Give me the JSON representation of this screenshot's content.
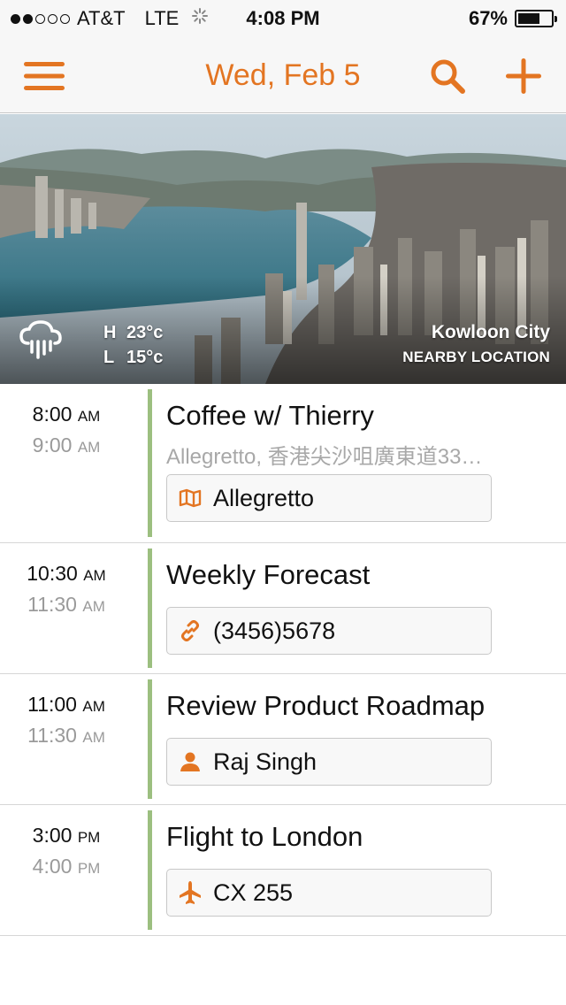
{
  "status_bar": {
    "carrier": "AT&T",
    "network": "LTE",
    "time": "4:08 PM",
    "battery": "67%",
    "battery_level": 0.67,
    "signal_bars_filled": 2,
    "signal_bars_total": 5
  },
  "nav": {
    "title": "Wed, Feb 5",
    "accent_color": "#e37522",
    "menu_icon": "menu-icon",
    "search_icon": "search-icon",
    "add_icon": "plus-icon"
  },
  "hero": {
    "weather_icon": "rain-cloud-icon",
    "high_label": "H",
    "high_temp": "23°c",
    "low_label": "L",
    "low_temp": "15°c",
    "location": "Kowloon City",
    "location_sub": "NEARBY LOCATION"
  },
  "events": [
    {
      "start_time": "8:00",
      "start_ampm": "AM",
      "end_time": "9:00",
      "end_ampm": "AM",
      "title": "Coffee w/ Thierry",
      "subtitle": "Allegretto, 香港尖沙咀廣東道33…",
      "chip_icon": "map-icon",
      "chip_label": "Allegretto"
    },
    {
      "start_time": "10:30",
      "start_ampm": "AM",
      "end_time": "11:30",
      "end_ampm": "AM",
      "title": "Weekly Forecast",
      "chip_icon": "link-icon",
      "chip_label": "(3456)5678"
    },
    {
      "start_time": "11:00",
      "start_ampm": "AM",
      "end_time": "11:30",
      "end_ampm": "AM",
      "title": "Review Product Roadmap",
      "chip_icon": "person-icon",
      "chip_label": "Raj Singh"
    },
    {
      "start_time": "3:00",
      "start_ampm": "PM",
      "end_time": "4:00",
      "end_ampm": "PM",
      "title": "Flight to London",
      "chip_icon": "airplane-icon",
      "chip_label": "CX 255"
    }
  ],
  "colors": {
    "accent": "#e37522",
    "event_bar": "#9cbf80",
    "secondary_text": "#9a9a9a"
  }
}
